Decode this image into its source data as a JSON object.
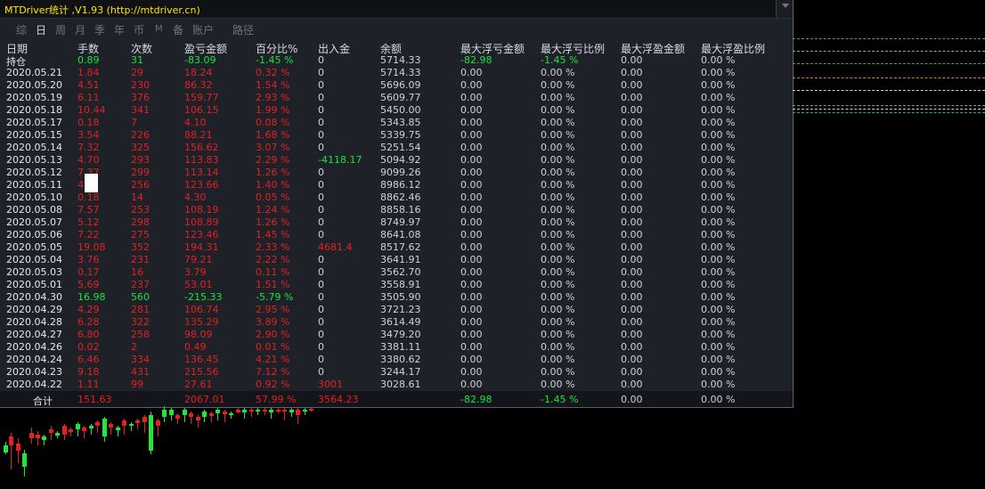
{
  "window": {
    "title": "MTDriver统计 ,V1.93 (http://mtdriver.cn)"
  },
  "tabs": [
    {
      "label": "综",
      "active": false
    },
    {
      "label": "日",
      "active": true
    },
    {
      "label": "周",
      "active": false
    },
    {
      "label": "月",
      "active": false
    },
    {
      "label": "季",
      "active": false
    },
    {
      "label": "年",
      "active": false
    },
    {
      "label": "币",
      "active": false
    },
    {
      "label": "M",
      "active": false
    },
    {
      "label": "备",
      "active": false
    },
    {
      "label": "账户",
      "active": false
    },
    {
      "label": "路径",
      "active": false
    }
  ],
  "columns": [
    "日期",
    "手数",
    "次数",
    "盈亏金额",
    "百分比%",
    "出入金",
    "余额",
    "最大浮亏金额",
    "最大浮亏比例",
    "最大浮盈金额",
    "最大浮盈比例"
  ],
  "holding_row": {
    "date": "持仓",
    "lots": "0.89",
    "count": "31",
    "pnl": "-83.09",
    "pct": "-1.45 %",
    "flow": "0",
    "balance": "5714.33",
    "max_float_loss": "-82.98",
    "max_float_loss_pct": "-1.45 %",
    "max_float_profit": "0.00",
    "max_float_profit_pct": "0.00 %"
  },
  "rows": [
    {
      "date": "2020.05.21",
      "lots": "1.84",
      "count": "29",
      "pnl": "18.24",
      "pct": "0.32 %",
      "flow": "0",
      "balance": "5714.33",
      "max_float_loss": "0.00",
      "max_float_loss_pct": "0.00 %",
      "max_float_profit": "0.00",
      "max_float_profit_pct": "0.00 %",
      "sign": "pos"
    },
    {
      "date": "2020.05.20",
      "lots": "4.51",
      "count": "230",
      "pnl": "86.32",
      "pct": "1.54 %",
      "flow": "0",
      "balance": "5696.09",
      "max_float_loss": "0.00",
      "max_float_loss_pct": "0.00 %",
      "max_float_profit": "0.00",
      "max_float_profit_pct": "0.00 %",
      "sign": "pos"
    },
    {
      "date": "2020.05.19",
      "lots": "6.11",
      "count": "376",
      "pnl": "159.77",
      "pct": "2.93 %",
      "flow": "0",
      "balance": "5609.77",
      "max_float_loss": "0.00",
      "max_float_loss_pct": "0.00 %",
      "max_float_profit": "0.00",
      "max_float_profit_pct": "0.00 %",
      "sign": "pos"
    },
    {
      "date": "2020.05.18",
      "lots": "10.44",
      "count": "341",
      "pnl": "106.15",
      "pct": "1.99 %",
      "flow": "0",
      "balance": "5450.00",
      "max_float_loss": "0.00",
      "max_float_loss_pct": "0.00 %",
      "max_float_profit": "0.00",
      "max_float_profit_pct": "0.00 %",
      "sign": "pos"
    },
    {
      "date": "2020.05.17",
      "lots": "0.18",
      "count": "7",
      "pnl": "4.10",
      "pct": "0.08 %",
      "flow": "0",
      "balance": "5343.85",
      "max_float_loss": "0.00",
      "max_float_loss_pct": "0.00 %",
      "max_float_profit": "0.00",
      "max_float_profit_pct": "0.00 %",
      "sign": "pos"
    },
    {
      "date": "2020.05.15",
      "lots": "3.54",
      "count": "226",
      "pnl": "88.21",
      "pct": "1.68 %",
      "flow": "0",
      "balance": "5339.75",
      "max_float_loss": "0.00",
      "max_float_loss_pct": "0.00 %",
      "max_float_profit": "0.00",
      "max_float_profit_pct": "0.00 %",
      "sign": "pos"
    },
    {
      "date": "2020.05.14",
      "lots": "7.32",
      "count": "325",
      "pnl": "156.62",
      "pct": "3.07 %",
      "flow": "0",
      "balance": "5251.54",
      "max_float_loss": "0.00",
      "max_float_loss_pct": "0.00 %",
      "max_float_profit": "0.00",
      "max_float_profit_pct": "0.00 %",
      "sign": "pos"
    },
    {
      "date": "2020.05.13",
      "lots": "4.70",
      "count": "293",
      "pnl": "113.83",
      "pct": "2.29 %",
      "flow": "-4118.17",
      "balance": "5094.92",
      "max_float_loss": "0.00",
      "max_float_loss_pct": "0.00 %",
      "max_float_profit": "0.00",
      "max_float_profit_pct": "0.00 %",
      "sign": "pos",
      "flow_sign": "neg"
    },
    {
      "date": "2020.05.12",
      "lots": "7.37",
      "count": "299",
      "pnl": "113.14",
      "pct": "1.26 %",
      "flow": "0",
      "balance": "9099.26",
      "max_float_loss": "0.00",
      "max_float_loss_pct": "0.00 %",
      "max_float_profit": "0.00",
      "max_float_profit_pct": "0.00 %",
      "sign": "pos"
    },
    {
      "date": "2020.05.11",
      "lots": "4.",
      "count": "256",
      "pnl": "123.66",
      "pct": "1.40 %",
      "flow": "0",
      "balance": "8986.12",
      "max_float_loss": "0.00",
      "max_float_loss_pct": "0.00 %",
      "max_float_profit": "0.00",
      "max_float_profit_pct": "0.00 %",
      "sign": "pos"
    },
    {
      "date": "2020.05.10",
      "lots": "0.18",
      "count": "14",
      "pnl": "4.30",
      "pct": "0.05 %",
      "flow": "0",
      "balance": "8862.46",
      "max_float_loss": "0.00",
      "max_float_loss_pct": "0.00 %",
      "max_float_profit": "0.00",
      "max_float_profit_pct": "0.00 %",
      "sign": "pos"
    },
    {
      "date": "2020.05.08",
      "lots": "7.57",
      "count": "253",
      "pnl": "108.19",
      "pct": "1.24 %",
      "flow": "0",
      "balance": "8858.16",
      "max_float_loss": "0.00",
      "max_float_loss_pct": "0.00 %",
      "max_float_profit": "0.00",
      "max_float_profit_pct": "0.00 %",
      "sign": "pos"
    },
    {
      "date": "2020.05.07",
      "lots": "5.12",
      "count": "298",
      "pnl": "108.89",
      "pct": "1.26 %",
      "flow": "0",
      "balance": "8749.97",
      "max_float_loss": "0.00",
      "max_float_loss_pct": "0.00 %",
      "max_float_profit": "0.00",
      "max_float_profit_pct": "0.00 %",
      "sign": "pos"
    },
    {
      "date": "2020.05.06",
      "lots": "7.22",
      "count": "275",
      "pnl": "123.46",
      "pct": "1.45 %",
      "flow": "0",
      "balance": "8641.08",
      "max_float_loss": "0.00",
      "max_float_loss_pct": "0.00 %",
      "max_float_profit": "0.00",
      "max_float_profit_pct": "0.00 %",
      "sign": "pos"
    },
    {
      "date": "2020.05.05",
      "lots": "19.08",
      "count": "352",
      "pnl": "194.31",
      "pct": "2.33 %",
      "flow": "4681.4",
      "balance": "8517.62",
      "max_float_loss": "0.00",
      "max_float_loss_pct": "0.00 %",
      "max_float_profit": "0.00",
      "max_float_profit_pct": "0.00 %",
      "sign": "pos",
      "flow_sign": "pos"
    },
    {
      "date": "2020.05.04",
      "lots": "3.76",
      "count": "231",
      "pnl": "79.21",
      "pct": "2.22 %",
      "flow": "0",
      "balance": "3641.91",
      "max_float_loss": "0.00",
      "max_float_loss_pct": "0.00 %",
      "max_float_profit": "0.00",
      "max_float_profit_pct": "0.00 %",
      "sign": "pos"
    },
    {
      "date": "2020.05.03",
      "lots": "0.17",
      "count": "16",
      "pnl": "3.79",
      "pct": "0.11 %",
      "flow": "0",
      "balance": "3562.70",
      "max_float_loss": "0.00",
      "max_float_loss_pct": "0.00 %",
      "max_float_profit": "0.00",
      "max_float_profit_pct": "0.00 %",
      "sign": "pos"
    },
    {
      "date": "2020.05.01",
      "lots": "5.69",
      "count": "237",
      "pnl": "53.01",
      "pct": "1.51 %",
      "flow": "0",
      "balance": "3558.91",
      "max_float_loss": "0.00",
      "max_float_loss_pct": "0.00 %",
      "max_float_profit": "0.00",
      "max_float_profit_pct": "0.00 %",
      "sign": "pos"
    },
    {
      "date": "2020.04.30",
      "lots": "16.98",
      "count": "560",
      "pnl": "-215.33",
      "pct": "-5.79 %",
      "flow": "0",
      "balance": "3505.90",
      "max_float_loss": "0.00",
      "max_float_loss_pct": "0.00 %",
      "max_float_profit": "0.00",
      "max_float_profit_pct": "0.00 %",
      "sign": "neg"
    },
    {
      "date": "2020.04.29",
      "lots": "4.29",
      "count": "281",
      "pnl": "106.74",
      "pct": "2.95 %",
      "flow": "0",
      "balance": "3721.23",
      "max_float_loss": "0.00",
      "max_float_loss_pct": "0.00 %",
      "max_float_profit": "0.00",
      "max_float_profit_pct": "0.00 %",
      "sign": "pos"
    },
    {
      "date": "2020.04.28",
      "lots": "6.28",
      "count": "322",
      "pnl": "135.29",
      "pct": "3.89 %",
      "flow": "0",
      "balance": "3614.49",
      "max_float_loss": "0.00",
      "max_float_loss_pct": "0.00 %",
      "max_float_profit": "0.00",
      "max_float_profit_pct": "0.00 %",
      "sign": "pos"
    },
    {
      "date": "2020.04.27",
      "lots": "6.80",
      "count": "258",
      "pnl": "98.09",
      "pct": "2.90 %",
      "flow": "0",
      "balance": "3479.20",
      "max_float_loss": "0.00",
      "max_float_loss_pct": "0.00 %",
      "max_float_profit": "0.00",
      "max_float_profit_pct": "0.00 %",
      "sign": "pos"
    },
    {
      "date": "2020.04.26",
      "lots": "0.02",
      "count": "2",
      "pnl": "0.49",
      "pct": "0.01 %",
      "flow": "0",
      "balance": "3381.11",
      "max_float_loss": "0.00",
      "max_float_loss_pct": "0.00 %",
      "max_float_profit": "0.00",
      "max_float_profit_pct": "0.00 %",
      "sign": "pos"
    },
    {
      "date": "2020.04.24",
      "lots": "6.46",
      "count": "334",
      "pnl": "136.45",
      "pct": "4.21 %",
      "flow": "0",
      "balance": "3380.62",
      "max_float_loss": "0.00",
      "max_float_loss_pct": "0.00 %",
      "max_float_profit": "0.00",
      "max_float_profit_pct": "0.00 %",
      "sign": "pos"
    },
    {
      "date": "2020.04.23",
      "lots": "9.18",
      "count": "431",
      "pnl": "215.56",
      "pct": "7.12 %",
      "flow": "0",
      "balance": "3244.17",
      "max_float_loss": "0.00",
      "max_float_loss_pct": "0.00 %",
      "max_float_profit": "0.00",
      "max_float_profit_pct": "0.00 %",
      "sign": "pos"
    },
    {
      "date": "2020.04.22",
      "lots": "1.11",
      "count": "99",
      "pnl": "27.61",
      "pct": "0.92 %",
      "flow": "3001",
      "balance": "3028.61",
      "max_float_loss": "0.00",
      "max_float_loss_pct": "0.00 %",
      "max_float_profit": "0.00",
      "max_float_profit_pct": "0.00 %",
      "sign": "pos",
      "flow_sign": "pos"
    }
  ],
  "total_row": {
    "label": "合计",
    "lots": "151.63",
    "pnl": "2067.01",
    "pct": "57.99 %",
    "flow": "3564.23",
    "max_float_loss": "-82.98",
    "max_float_loss_pct": "-1.45 %",
    "max_float_profit": "0.00",
    "max_float_profit_pct": "0.00 %"
  },
  "colors": {
    "positive": "#e52020",
    "negative": "#18e43c",
    "neutral": "#cfd2d6",
    "title": "#ffe600",
    "window_bg": "#1e2128",
    "chart_bg": "#000000"
  }
}
